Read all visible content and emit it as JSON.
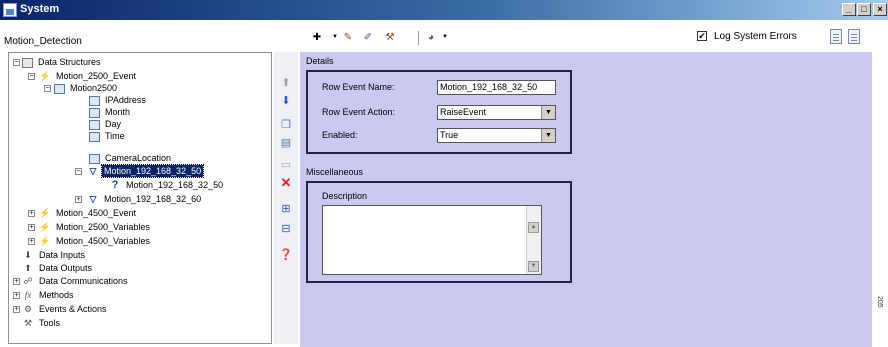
{
  "window": {
    "title": "System",
    "min_glyph": "_",
    "max_glyph": "□",
    "close_glyph": "×"
  },
  "toolbar": {
    "module_name": "Motion_Detection",
    "log_errors_label": "Log System Errors",
    "log_errors_checked": "✔",
    "icons": [
      "add-dropdown-icon",
      "add-item-icon",
      "edit-icon",
      "tools-icon",
      "globe-dropdown-icon",
      "document-icon",
      "edit-document-icon"
    ]
  },
  "tree": {
    "items": [
      {
        "label": "Data Structures",
        "icon": "ds-icon"
      },
      {
        "label": "Motion_2500_Event",
        "icon": "event-icon"
      },
      {
        "label": "Motion2500",
        "icon": "table-icon"
      },
      {
        "label": "IPAddress",
        "icon": "table-icon"
      },
      {
        "label": "Month",
        "icon": "table-icon"
      },
      {
        "label": "Day",
        "icon": "table-icon"
      },
      {
        "label": "Time",
        "icon": "table-icon"
      },
      {
        "label": "CameraLocation",
        "icon": "table-icon"
      },
      {
        "label": "Motion_192_168_32_50",
        "icon": "filter-icon",
        "selected": true
      },
      {
        "label": "Motion_192_168_32_50",
        "icon": "question-icon"
      },
      {
        "label": "Motion_192_168_32_60",
        "icon": "filter-icon"
      },
      {
        "label": "Motion_4500_Event",
        "icon": "event-icon"
      },
      {
        "label": "Motion_2500_Variables",
        "icon": "event-icon"
      },
      {
        "label": "Motion_4500_Variables",
        "icon": "event-icon"
      },
      {
        "label": "Data Inputs",
        "icon": "input-icon"
      },
      {
        "label": "Data Outputs",
        "icon": "output-icon"
      },
      {
        "label": "Data Communications",
        "icon": "comm-icon"
      },
      {
        "label": "Methods",
        "icon": "fx-icon"
      },
      {
        "label": "Events & Actions",
        "icon": "events-icon"
      },
      {
        "label": "Tools",
        "icon": "tools-icon"
      }
    ]
  },
  "mid_toolbar": {
    "icons": [
      "move-up-icon",
      "move-down-icon",
      "copy-icon",
      "paste-icon",
      "cut-icon",
      "delete-icon",
      "expand-icon",
      "collapse-icon",
      "help-icon"
    ]
  },
  "details": {
    "title": "Details",
    "row_event_name_label": "Row Event Name:",
    "row_event_name_value": "Motion_192_168_32_50",
    "row_event_action_label": "Row Event Action:",
    "row_event_action_value": "RaiseEvent",
    "enabled_label": "Enabled:",
    "enabled_value": "True"
  },
  "misc": {
    "title": "Miscellaneous",
    "description_label": "Description",
    "description_value": ""
  },
  "edge_text": "205"
}
